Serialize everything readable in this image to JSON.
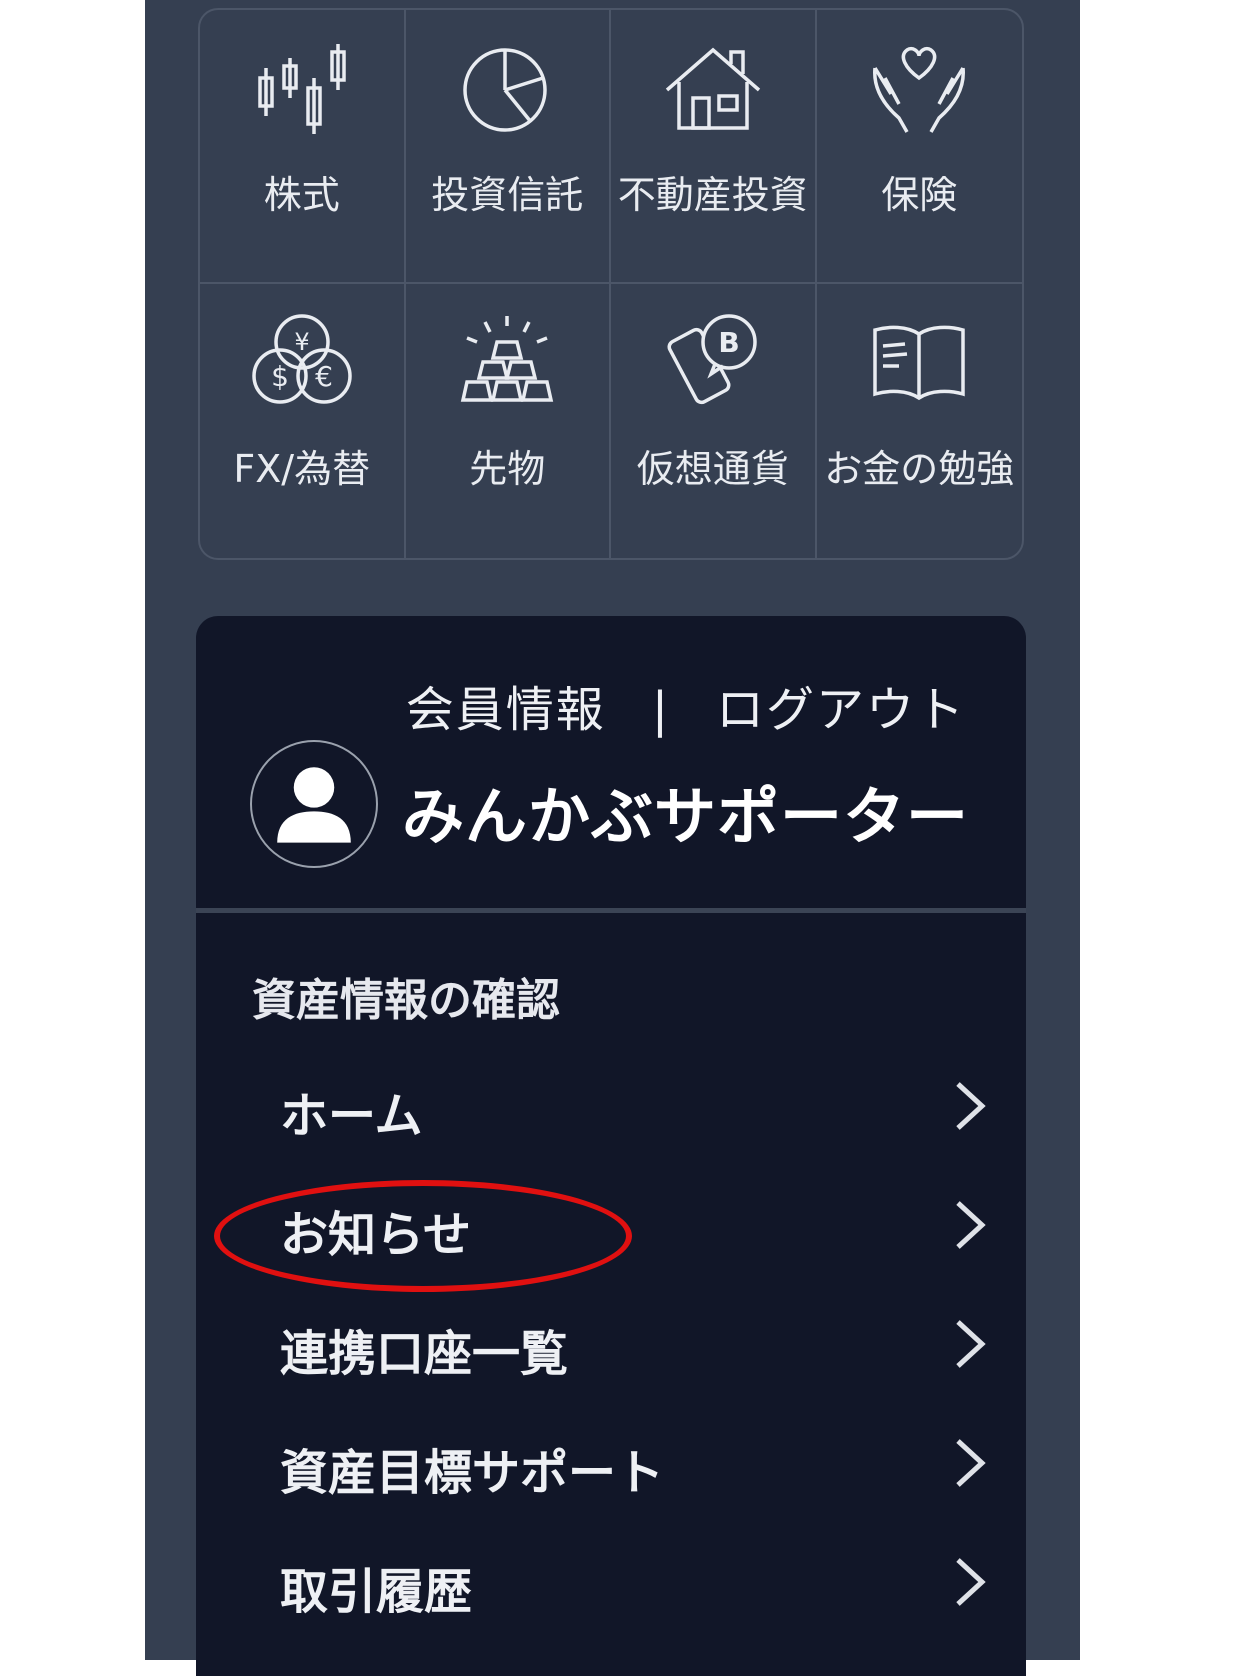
{
  "categories": [
    {
      "label": "株式",
      "icon": "candlestick-chart-icon"
    },
    {
      "label": "投資信託",
      "icon": "pie-chart-icon"
    },
    {
      "label": "不動産投資",
      "icon": "house-icon"
    },
    {
      "label": "保険",
      "icon": "hands-heart-icon"
    },
    {
      "label": "FX/為替",
      "icon": "currency-coins-icon"
    },
    {
      "label": "先物",
      "icon": "gold-bars-icon"
    },
    {
      "label": "仮想通貨",
      "icon": "phone-bitcoin-icon"
    },
    {
      "label": "お金の勉強",
      "icon": "open-book-icon"
    }
  ],
  "account": {
    "member_info": "会員情報",
    "separator": "|",
    "logout": "ログアウト",
    "username": "みんかぶサポーター"
  },
  "menu": {
    "section_title": "資産情報の確認",
    "items": [
      {
        "label": "ホーム"
      },
      {
        "label": "お知らせ"
      },
      {
        "label": "連携口座一覧"
      },
      {
        "label": "資産目標サポート"
      },
      {
        "label": "取引履歴"
      }
    ]
  },
  "colors": {
    "panel": "#353f51",
    "card": "#111628",
    "highlight": "#e01010"
  }
}
